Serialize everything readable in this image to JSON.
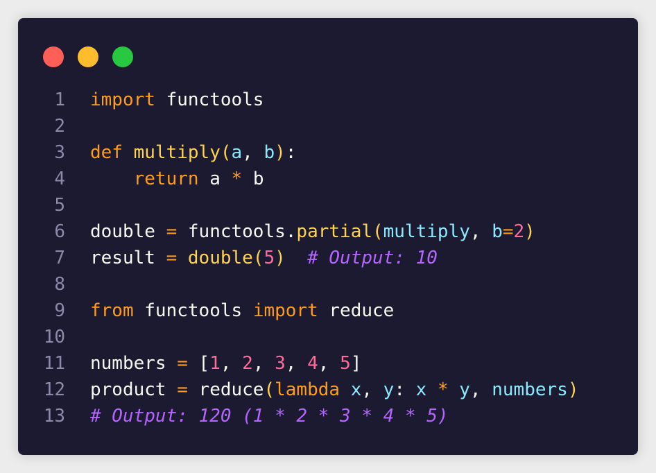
{
  "window": {
    "buttons": [
      "close",
      "minimize",
      "maximize"
    ],
    "colors": {
      "background": "#1b1a30",
      "close": "#ff5f57",
      "minimize": "#ffbd2e",
      "maximize": "#28c840",
      "keyword": "#ff9c1a",
      "function": "#ffd34d",
      "parameter": "#8be9fd",
      "number": "#ff6b9a",
      "comment": "#b565ff",
      "plain": "#f8f8f2",
      "line_number": "#8b8aa8"
    }
  },
  "code": {
    "language": "python",
    "lines": [
      {
        "n": "1",
        "tokens": [
          [
            "kw",
            "import"
          ],
          [
            "pl",
            " functools"
          ]
        ]
      },
      {
        "n": "2",
        "tokens": []
      },
      {
        "n": "3",
        "tokens": [
          [
            "kw",
            "def"
          ],
          [
            "pl",
            " "
          ],
          [
            "fn",
            "multiply"
          ],
          [
            "fn",
            "("
          ],
          [
            "param",
            "a"
          ],
          [
            "pl",
            ", "
          ],
          [
            "param",
            "b"
          ],
          [
            "fn",
            ")"
          ],
          [
            "pl",
            ":"
          ]
        ]
      },
      {
        "n": "4",
        "tokens": [
          [
            "pl",
            "    "
          ],
          [
            "kw",
            "return"
          ],
          [
            "pl",
            " a "
          ],
          [
            "op",
            "*"
          ],
          [
            "pl",
            " b"
          ]
        ]
      },
      {
        "n": "5",
        "tokens": []
      },
      {
        "n": "6",
        "tokens": [
          [
            "pl",
            "double "
          ],
          [
            "op",
            "="
          ],
          [
            "pl",
            " functools."
          ],
          [
            "fn",
            "partial("
          ],
          [
            "param",
            "multiply"
          ],
          [
            "pl",
            ", "
          ],
          [
            "param",
            "b"
          ],
          [
            "op",
            "="
          ],
          [
            "num",
            "2"
          ],
          [
            "fn",
            ")"
          ]
        ]
      },
      {
        "n": "7",
        "tokens": [
          [
            "pl",
            "result "
          ],
          [
            "op",
            "="
          ],
          [
            "pl",
            " "
          ],
          [
            "fn",
            "double("
          ],
          [
            "num",
            "5"
          ],
          [
            "fn",
            ")"
          ],
          [
            "pl",
            "  "
          ],
          [
            "cm",
            "# Output: 10"
          ]
        ]
      },
      {
        "n": "8",
        "tokens": []
      },
      {
        "n": "9",
        "tokens": [
          [
            "kw",
            "from"
          ],
          [
            "pl",
            " functools "
          ],
          [
            "kw",
            "import"
          ],
          [
            "pl",
            " reduce"
          ]
        ]
      },
      {
        "n": "10",
        "tokens": []
      },
      {
        "n": "11",
        "tokens": [
          [
            "pl",
            "numbers "
          ],
          [
            "op",
            "="
          ],
          [
            "pl",
            " ["
          ],
          [
            "num",
            "1"
          ],
          [
            "pl",
            ", "
          ],
          [
            "num",
            "2"
          ],
          [
            "pl",
            ", "
          ],
          [
            "num",
            "3"
          ],
          [
            "pl",
            ", "
          ],
          [
            "num",
            "4"
          ],
          [
            "pl",
            ", "
          ],
          [
            "num",
            "5"
          ],
          [
            "pl",
            "]"
          ]
        ]
      },
      {
        "n": "12",
        "tokens": [
          [
            "pl",
            "product "
          ],
          [
            "op",
            "="
          ],
          [
            "pl",
            " reduce"
          ],
          [
            "fn",
            "("
          ],
          [
            "kw",
            "lambda"
          ],
          [
            "pl",
            " "
          ],
          [
            "param",
            "x"
          ],
          [
            "pl",
            ", "
          ],
          [
            "param",
            "y"
          ],
          [
            "pl",
            ": "
          ],
          [
            "param",
            "x"
          ],
          [
            "pl",
            " "
          ],
          [
            "op",
            "*"
          ],
          [
            "pl",
            " "
          ],
          [
            "param",
            "y"
          ],
          [
            "pl",
            ", "
          ],
          [
            "param",
            "numbers"
          ],
          [
            "fn",
            ")"
          ]
        ]
      },
      {
        "n": "13",
        "tokens": [
          [
            "cm",
            "# Output: 120 (1 * 2 * 3 * 4 * 5)"
          ]
        ]
      }
    ]
  }
}
